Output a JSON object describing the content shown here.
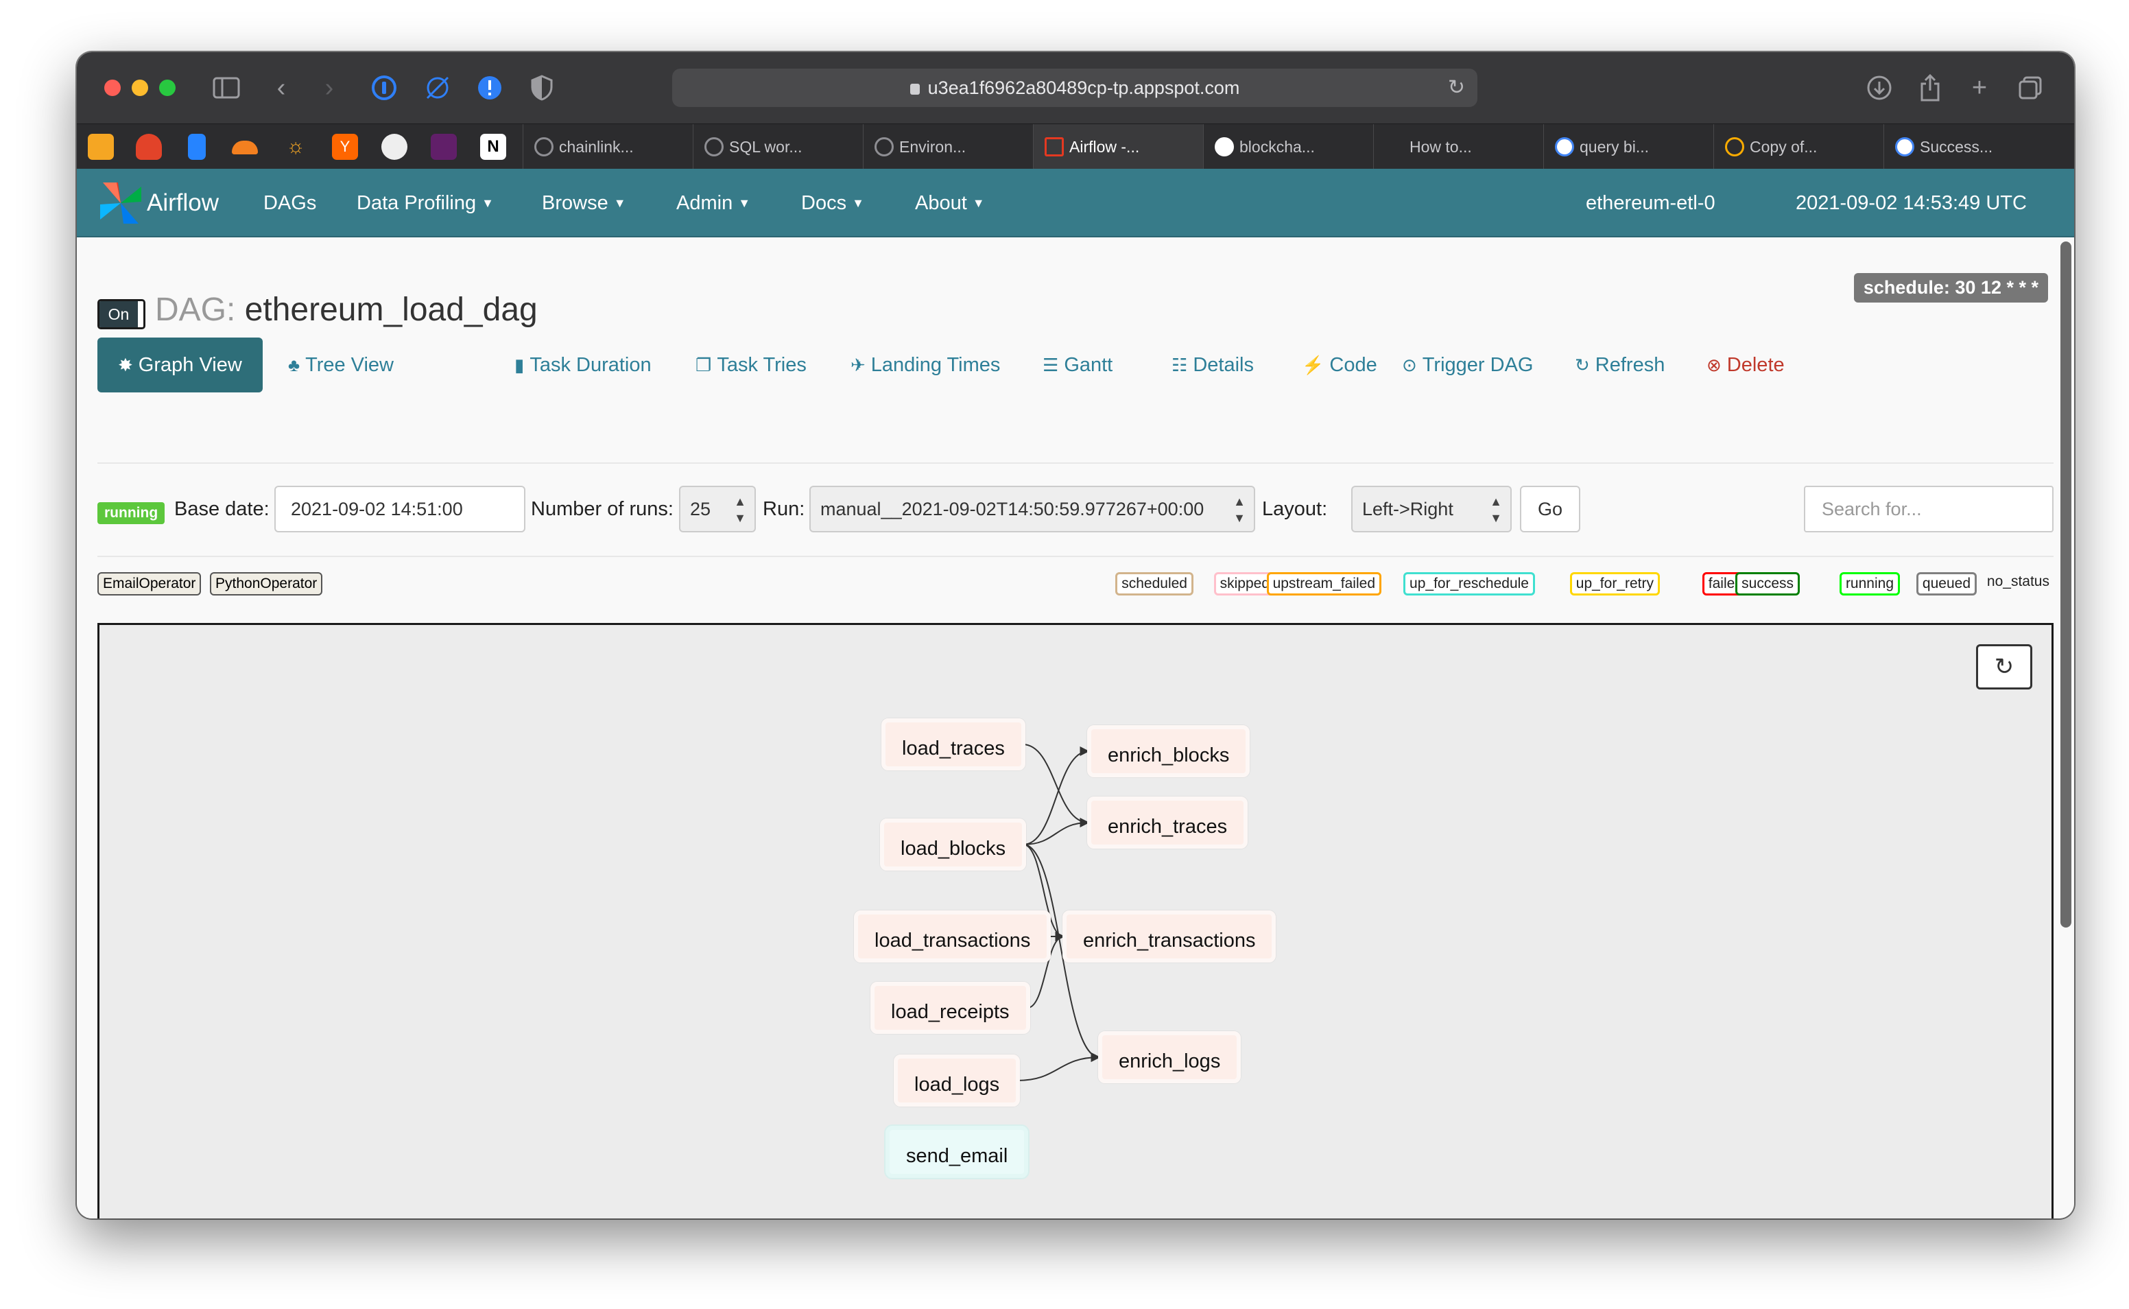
{
  "browser": {
    "url": "u3ea1f6962a80489cp-tp.appspot.com",
    "tabs": [
      {
        "label": "chainlink..."
      },
      {
        "label": "SQL wor..."
      },
      {
        "label": "Environ..."
      },
      {
        "label": "Airflow -..."
      },
      {
        "label": "blockcha..."
      },
      {
        "label": "How to..."
      },
      {
        "label": "query bi..."
      },
      {
        "label": "Copy of..."
      },
      {
        "label": "Success..."
      }
    ]
  },
  "navbar": {
    "brand": "Airflow",
    "items": [
      "DAGs",
      "Data Profiling",
      "Browse",
      "Admin",
      "Docs",
      "About"
    ],
    "env": "ethereum-etl-0",
    "datetime": "2021-09-02 14:53:49 UTC"
  },
  "dag": {
    "toggle": "On",
    "title_prefix": "DAG:",
    "title": "ethereum_load_dag",
    "schedule": "schedule: 30 12 * * *"
  },
  "view_tabs": [
    {
      "label": "Graph View",
      "icon": "asterisk-icon"
    },
    {
      "label": "Tree View",
      "icon": "tree-icon"
    },
    {
      "label": "Task Duration",
      "icon": "bar-chart-icon"
    },
    {
      "label": "Task Tries",
      "icon": "files-icon"
    },
    {
      "label": "Landing Times",
      "icon": "plane-icon"
    },
    {
      "label": "Gantt",
      "icon": "gantt-icon"
    },
    {
      "label": "Details",
      "icon": "list-icon"
    },
    {
      "label": "Code",
      "icon": "bolt-icon"
    },
    {
      "label": "Trigger DAG",
      "icon": "play-circle-icon"
    },
    {
      "label": "Refresh",
      "icon": "refresh-icon"
    },
    {
      "label": "Delete",
      "icon": "remove-circle-icon"
    }
  ],
  "form": {
    "state_badge": "running",
    "base_date_label": "Base date:",
    "base_date": "2021-09-02 14:51:00",
    "runs_label": "Number of runs:",
    "runs": "25",
    "run_label": "Run:",
    "run": "manual__2021-09-02T14:50:59.977267+00:00",
    "layout_label": "Layout:",
    "layout": "Left->Right",
    "go": "Go",
    "search_placeholder": "Search for..."
  },
  "operators": [
    "EmailOperator",
    "PythonOperator"
  ],
  "states": [
    {
      "label": "scheduled",
      "color": "#d2b48c"
    },
    {
      "label": "skipped",
      "color": "#ffc0cb"
    },
    {
      "label": "upstream_failed",
      "color": "#ffa500"
    },
    {
      "label": "up_for_reschedule",
      "color": "#40e0d0"
    },
    {
      "label": "up_for_retry",
      "color": "#ffd700"
    },
    {
      "label": "failed",
      "color": "#ff0000"
    },
    {
      "label": "success",
      "color": "#008000"
    },
    {
      "label": "running",
      "color": "#00ff00"
    },
    {
      "label": "queued",
      "color": "#808080"
    },
    {
      "label": "no_status",
      "color": "#ffffff"
    }
  ],
  "graph": {
    "nodes": [
      {
        "id": "load_traces",
        "label": "load_traces",
        "operator": "PythonOperator"
      },
      {
        "id": "enrich_blocks",
        "label": "enrich_blocks",
        "operator": "PythonOperator"
      },
      {
        "id": "enrich_traces",
        "label": "enrich_traces",
        "operator": "PythonOperator"
      },
      {
        "id": "load_blocks",
        "label": "load_blocks",
        "operator": "PythonOperator"
      },
      {
        "id": "load_transactions",
        "label": "load_transactions",
        "operator": "PythonOperator"
      },
      {
        "id": "enrich_transactions",
        "label": "enrich_transactions",
        "operator": "PythonOperator"
      },
      {
        "id": "load_receipts",
        "label": "load_receipts",
        "operator": "PythonOperator"
      },
      {
        "id": "enrich_logs",
        "label": "enrich_logs",
        "operator": "PythonOperator"
      },
      {
        "id": "load_logs",
        "label": "load_logs",
        "operator": "PythonOperator"
      },
      {
        "id": "send_email",
        "label": "send_email",
        "operator": "EmailOperator"
      }
    ],
    "edges": [
      [
        "load_traces",
        "enrich_traces"
      ],
      [
        "load_blocks",
        "enrich_blocks"
      ],
      [
        "load_blocks",
        "enrich_traces"
      ],
      [
        "load_blocks",
        "enrich_transactions"
      ],
      [
        "load_blocks",
        "enrich_logs"
      ],
      [
        "load_transactions",
        "enrich_transactions"
      ],
      [
        "load_receipts",
        "enrich_transactions"
      ],
      [
        "load_logs",
        "enrich_logs"
      ]
    ]
  }
}
